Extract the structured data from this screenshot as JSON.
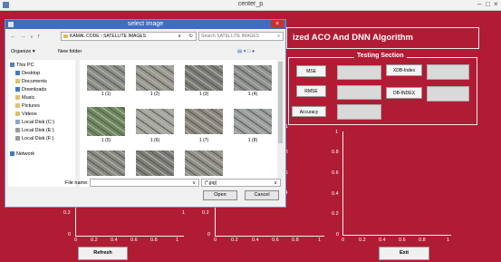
{
  "window": {
    "title": "center_p",
    "minimize": "–",
    "maximize": "□",
    "close": "×"
  },
  "heading": "ized ACO And DNN Algorithm",
  "testing": {
    "title": "Testing Section",
    "mse": "MSE",
    "rmse": "RMSE",
    "accuracy": "Accuracy",
    "xdb": "XDB-Index",
    "db": "DB-INDEX"
  },
  "axes": {
    "bottom_left_y": [
      "0.2",
      "0"
    ],
    "bottom_left_x": [
      "0",
      "0.2",
      "0.4",
      "0.6",
      "0.8",
      "1"
    ],
    "middle_y": [
      "0.2",
      "0"
    ],
    "middle_x": [
      "0",
      "0.2",
      "0.4",
      "0.6",
      "0.8",
      "1"
    ],
    "right_y": [
      "1",
      "0.8",
      "0.6",
      "0.4",
      "0.2",
      "0"
    ],
    "right_x": [
      "0",
      "0.2",
      "0.4",
      "0.6",
      "0.8",
      "1"
    ],
    "partial_x": "1",
    "partial_y": [
      "1",
      "0.8",
      "0.6",
      "0.4"
    ]
  },
  "buttons": {
    "refresh": "Refresh",
    "exit": "Exit"
  },
  "dialog": {
    "title": "select image",
    "close": "×",
    "nav": {
      "back": "←",
      "forward": "→",
      "dropdown": "∨",
      "up": "↑"
    },
    "breadcrumb": "KAMAL CODE  ›  SATELLITE IMAGES",
    "breadcrumb_dropdown": "∨",
    "refresh_icon": "↻",
    "search_placeholder": "Search SATELLITE IMAGES",
    "search_icon": "⌕",
    "organize": "Organize ▾",
    "new_folder": "New folder",
    "view_icons": "▤ ▾  □  ●",
    "sidebar": [
      {
        "label": "This PC",
        "color": "#5b7fb8"
      },
      {
        "label": "Desktop",
        "color": "#3d7ac9"
      },
      {
        "label": "Documents",
        "color": "#e0c070"
      },
      {
        "label": "Downloads",
        "color": "#3d7ac9"
      },
      {
        "label": "Music",
        "color": "#e0c070"
      },
      {
        "label": "Pictures",
        "color": "#e0c070"
      },
      {
        "label": "Videos",
        "color": "#e0c070"
      },
      {
        "label": "Local Disk (C:)",
        "color": "#8fa6c8"
      },
      {
        "label": "Local Disk (E:)",
        "color": "#9a9a9a"
      },
      {
        "label": "Local Disk (F:)",
        "color": "#9a9a9a"
      },
      {
        "label": "Network",
        "color": "#3d7ac9"
      }
    ],
    "files": [
      {
        "name": "1 (1)",
        "color": "#8a8f88"
      },
      {
        "name": "1 (2)",
        "color": "#9a9a92"
      },
      {
        "name": "1 (3)",
        "color": "#7d7d78"
      },
      {
        "name": "1 (4)",
        "color": "#8e9290"
      },
      {
        "name": "1 (5)",
        "color": "#6d8a5e"
      },
      {
        "name": "1 (6)",
        "color": "#a6a6a0"
      },
      {
        "name": "1 (7)",
        "color": "#8c8880"
      },
      {
        "name": "1 (8)",
        "color": "#9a9ea0"
      },
      {
        "name": "",
        "color": "#8a8a84"
      },
      {
        "name": "",
        "color": "#7e7e78"
      },
      {
        "name": "",
        "color": "#8f8f88"
      }
    ],
    "filename_label": "File name:",
    "filename_value": "",
    "filename_dropdown": "∨",
    "filetype": "(*.jpg)",
    "filetype_dropdown": "∨",
    "open": "Open",
    "cancel": "Cancel"
  }
}
